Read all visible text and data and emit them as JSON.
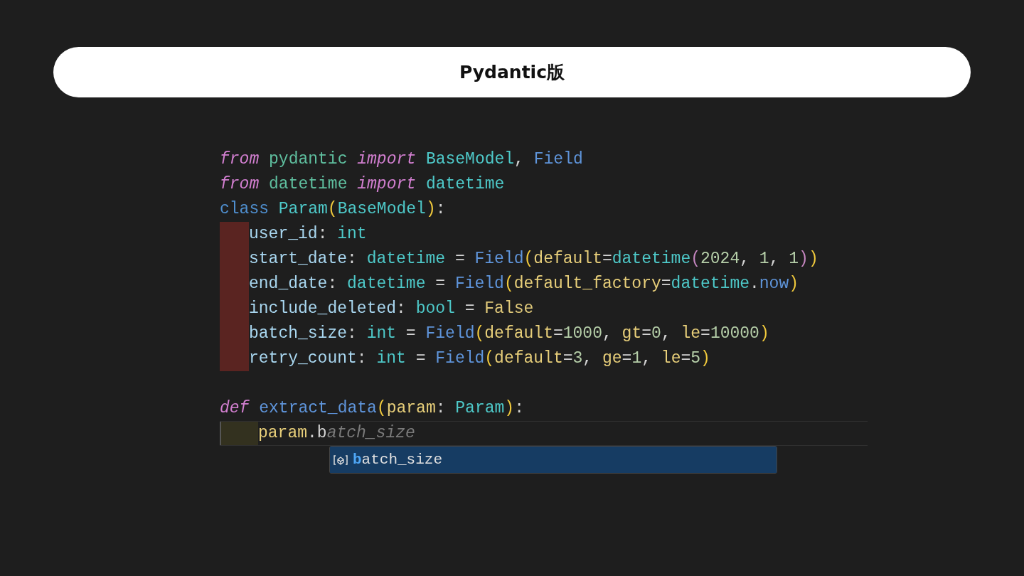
{
  "title": "Pydantic版",
  "code_lines": [
    {
      "kind": "plain",
      "tokens": [
        {
          "kind": "keyword",
          "text": "from"
        },
        {
          "kind": "module",
          "text": " pydantic"
        },
        {
          "kind": "keyword",
          "text": " import"
        },
        {
          "kind": "type",
          "text": " BaseModel"
        },
        {
          "kind": "plain",
          "text": ","
        },
        {
          "kind": "func",
          "text": " Field"
        }
      ]
    },
    {
      "kind": "plain",
      "tokens": [
        {
          "kind": "keyword",
          "text": "from"
        },
        {
          "kind": "module",
          "text": " datetime"
        },
        {
          "kind": "keyword",
          "text": " import"
        },
        {
          "kind": "type",
          "text": " datetime"
        }
      ]
    },
    {
      "kind": "plain",
      "tokens": [
        {
          "kind": "storage",
          "text": "class"
        },
        {
          "kind": "type",
          "text": " Param"
        },
        {
          "kind": "paren",
          "text": "("
        },
        {
          "kind": "type",
          "text": "BaseModel"
        },
        {
          "kind": "paren",
          "text": ")"
        },
        {
          "kind": "plain",
          "text": ":"
        }
      ]
    },
    {
      "kind": "error",
      "tokens": [
        {
          "kind": "variable",
          "text": "user_id"
        },
        {
          "kind": "plain",
          "text": ":"
        },
        {
          "kind": "type",
          "text": " int"
        }
      ]
    },
    {
      "kind": "error",
      "tokens": [
        {
          "kind": "variable",
          "text": "start_date"
        },
        {
          "kind": "plain",
          "text": ":"
        },
        {
          "kind": "type",
          "text": " datetime"
        },
        {
          "kind": "plain",
          "text": " ="
        },
        {
          "kind": "func",
          "text": " Field"
        },
        {
          "kind": "paren",
          "text": "("
        },
        {
          "kind": "param",
          "text": "default"
        },
        {
          "kind": "plain",
          "text": "="
        },
        {
          "kind": "type",
          "text": "datetime"
        },
        {
          "kind": "paren2",
          "text": "("
        },
        {
          "kind": "number",
          "text": "2024"
        },
        {
          "kind": "plain",
          "text": ","
        },
        {
          "kind": "number",
          "text": " 1"
        },
        {
          "kind": "plain",
          "text": ","
        },
        {
          "kind": "number",
          "text": " 1"
        },
        {
          "kind": "paren2",
          "text": ")"
        },
        {
          "kind": "paren",
          "text": ")"
        }
      ]
    },
    {
      "kind": "error",
      "tokens": [
        {
          "kind": "variable",
          "text": "end_date"
        },
        {
          "kind": "plain",
          "text": ":"
        },
        {
          "kind": "type",
          "text": " datetime"
        },
        {
          "kind": "plain",
          "text": " ="
        },
        {
          "kind": "func",
          "text": " Field"
        },
        {
          "kind": "paren",
          "text": "("
        },
        {
          "kind": "param",
          "text": "default_factory"
        },
        {
          "kind": "plain",
          "text": "="
        },
        {
          "kind": "type",
          "text": "datetime"
        },
        {
          "kind": "plain",
          "text": "."
        },
        {
          "kind": "func",
          "text": "now"
        },
        {
          "kind": "paren",
          "text": ")"
        }
      ]
    },
    {
      "kind": "error",
      "tokens": [
        {
          "kind": "variable",
          "text": "include_deleted"
        },
        {
          "kind": "plain",
          "text": ":"
        },
        {
          "kind": "type",
          "text": " bool"
        },
        {
          "kind": "plain",
          "text": " ="
        },
        {
          "kind": "constant",
          "text": " False"
        }
      ]
    },
    {
      "kind": "error",
      "tokens": [
        {
          "kind": "variable",
          "text": "batch_size"
        },
        {
          "kind": "plain",
          "text": ":"
        },
        {
          "kind": "type",
          "text": " int"
        },
        {
          "kind": "plain",
          "text": " ="
        },
        {
          "kind": "func",
          "text": " Field"
        },
        {
          "kind": "paren",
          "text": "("
        },
        {
          "kind": "param",
          "text": "default"
        },
        {
          "kind": "plain",
          "text": "="
        },
        {
          "kind": "number",
          "text": "1000"
        },
        {
          "kind": "plain",
          "text": ","
        },
        {
          "kind": "param",
          "text": " gt"
        },
        {
          "kind": "plain",
          "text": "="
        },
        {
          "kind": "number",
          "text": "0"
        },
        {
          "kind": "plain",
          "text": ","
        },
        {
          "kind": "param",
          "text": " le"
        },
        {
          "kind": "plain",
          "text": "="
        },
        {
          "kind": "number",
          "text": "10000"
        },
        {
          "kind": "paren",
          "text": ")"
        }
      ]
    },
    {
      "kind": "error",
      "tokens": [
        {
          "kind": "variable",
          "text": "retry_count"
        },
        {
          "kind": "plain",
          "text": ":"
        },
        {
          "kind": "type",
          "text": " int"
        },
        {
          "kind": "plain",
          "text": " ="
        },
        {
          "kind": "func",
          "text": " Field"
        },
        {
          "kind": "paren",
          "text": "("
        },
        {
          "kind": "param",
          "text": "default"
        },
        {
          "kind": "plain",
          "text": "="
        },
        {
          "kind": "number",
          "text": "3"
        },
        {
          "kind": "plain",
          "text": ","
        },
        {
          "kind": "param",
          "text": " ge"
        },
        {
          "kind": "plain",
          "text": "="
        },
        {
          "kind": "number",
          "text": "1"
        },
        {
          "kind": "plain",
          "text": ","
        },
        {
          "kind": "param",
          "text": " le"
        },
        {
          "kind": "plain",
          "text": "="
        },
        {
          "kind": "number",
          "text": "5"
        },
        {
          "kind": "paren",
          "text": ")"
        }
      ]
    },
    {
      "kind": "blank"
    },
    {
      "kind": "plain",
      "tokens": [
        {
          "kind": "keyword",
          "text": "def"
        },
        {
          "kind": "func",
          "text": " extract_data"
        },
        {
          "kind": "paren",
          "text": "("
        },
        {
          "kind": "param",
          "text": "param"
        },
        {
          "kind": "plain",
          "text": ":"
        },
        {
          "kind": "type",
          "text": " Param"
        },
        {
          "kind": "paren",
          "text": ")"
        },
        {
          "kind": "plain",
          "text": ":"
        }
      ]
    },
    {
      "kind": "current",
      "tokens": [
        {
          "kind": "param",
          "text": "param"
        },
        {
          "kind": "plain",
          "text": ".b"
        },
        {
          "kind": "ghost",
          "text": "atch_size"
        }
      ]
    }
  ],
  "suggestions": [
    {
      "match": "b",
      "rest": "atch_size",
      "selected": true
    }
  ]
}
